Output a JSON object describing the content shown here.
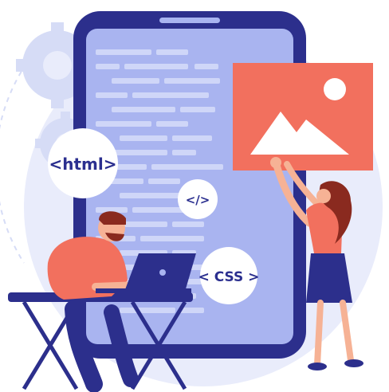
{
  "bubbles": {
    "html": "<html>",
    "code": "</>",
    "css": "< CSS >"
  },
  "colors": {
    "phone_body": "#2c2f8c",
    "phone_screen": "#a9b4f0",
    "code_lines": "#cfd6f8",
    "background_circle": "#e9ecfb",
    "gear": "#d6dcf6",
    "picture_frame": "#f2705e",
    "picture_icon": "#ffffff",
    "shirt": "#f2705e",
    "pants": "#2c2f8c",
    "hair": "#8a2a1f",
    "skin": "#f6b295",
    "desk": "#2c2f8c",
    "laptop": "#2c2f8c",
    "bubble_fill": "#ffffff",
    "bubble_text": "#2b2f8f"
  },
  "icons": {
    "picture": "image-icon",
    "gears": "gear-icon"
  }
}
